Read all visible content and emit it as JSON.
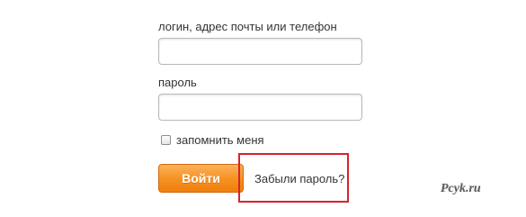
{
  "login_form": {
    "login_label": "логин, адрес почты или телефон",
    "login_value": "",
    "password_label": "пароль",
    "password_value": "",
    "remember_label": "запомнить меня",
    "remember_checked": false,
    "submit_label": "Войти",
    "forgot_label": "Забыли пароль?"
  },
  "annotation": {
    "highlight_color": "#d8232a"
  },
  "watermark": {
    "text": "Pcyk.ru"
  },
  "colors": {
    "button_orange": "#f6901f",
    "text": "#333333"
  }
}
